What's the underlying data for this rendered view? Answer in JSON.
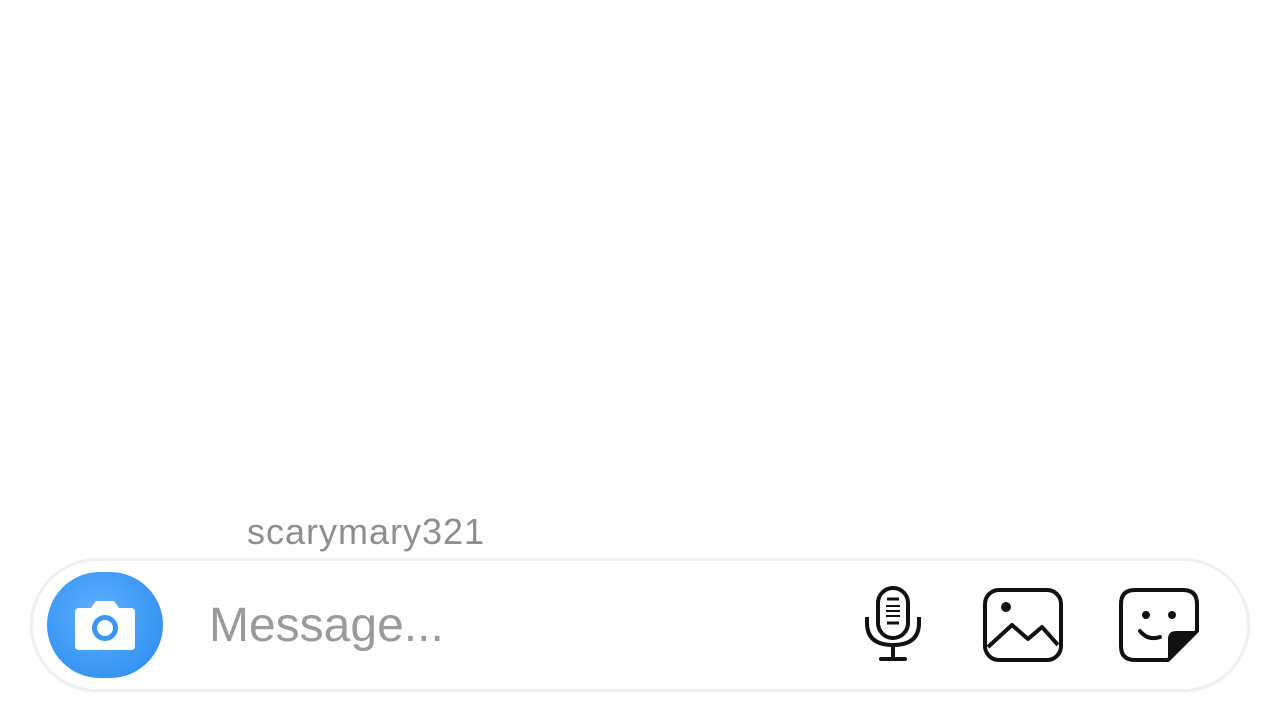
{
  "thread": {
    "sender_name": "scarymary321"
  },
  "composer": {
    "placeholder": "Message...",
    "value": "",
    "icons": {
      "camera": "camera-icon",
      "microphone": "microphone-icon",
      "gallery": "gallery-icon",
      "sticker": "sticker-icon"
    },
    "accent_color": "#3897f0"
  }
}
